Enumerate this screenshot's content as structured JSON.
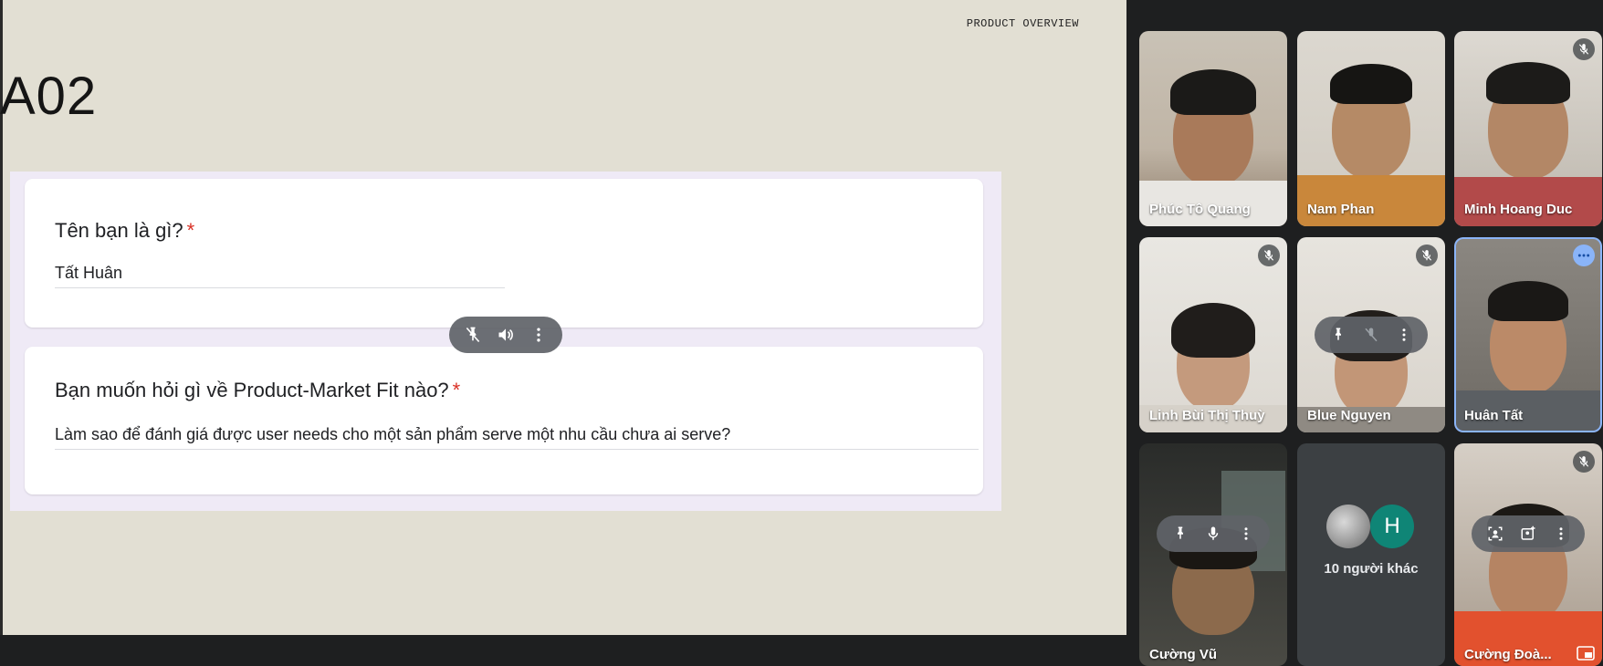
{
  "slide": {
    "overline": "PRODUCT OVERVIEW",
    "title": "A02"
  },
  "form": {
    "q1": {
      "label": "Tên bạn là gì?",
      "required_mark": "*",
      "answer": "Tất Huân"
    },
    "q2": {
      "label": "Bạn muốn hỏi gì về Product-Market Fit nào?",
      "required_mark": "*",
      "answer": "Làm sao để đánh giá được user needs cho một sản phẩm serve một nhu cầu chưa ai serve?"
    }
  },
  "participants": [
    {
      "name": "Phúc Tô Quang",
      "muted": false
    },
    {
      "name": "Nam Phan",
      "muted": false
    },
    {
      "name": "Minh Hoang Duc",
      "muted": true
    },
    {
      "name": "Linh Bùi Thị Thuỳ",
      "muted": true
    },
    {
      "name": "Blue Nguyen",
      "muted": true
    },
    {
      "name": "Huân Tất",
      "muted": false
    },
    {
      "name": "Cường Vũ",
      "muted": false
    },
    {
      "name": "Cường Đoà...",
      "muted": true
    }
  ],
  "others": {
    "initial": "H",
    "label": "10 người khác"
  },
  "colors": {
    "stage_bg": "#e2dfd3",
    "form_bg": "#efeaf6",
    "required": "#d93025",
    "active_ring": "#8ab4f8",
    "avatar_h": "#0f8576"
  },
  "icons": [
    "unpin-icon",
    "volume-icon",
    "more-vert-icon",
    "pin-icon",
    "mic-icon",
    "mic-off-icon",
    "frame-icon",
    "add-photo-icon",
    "pip-icon"
  ]
}
